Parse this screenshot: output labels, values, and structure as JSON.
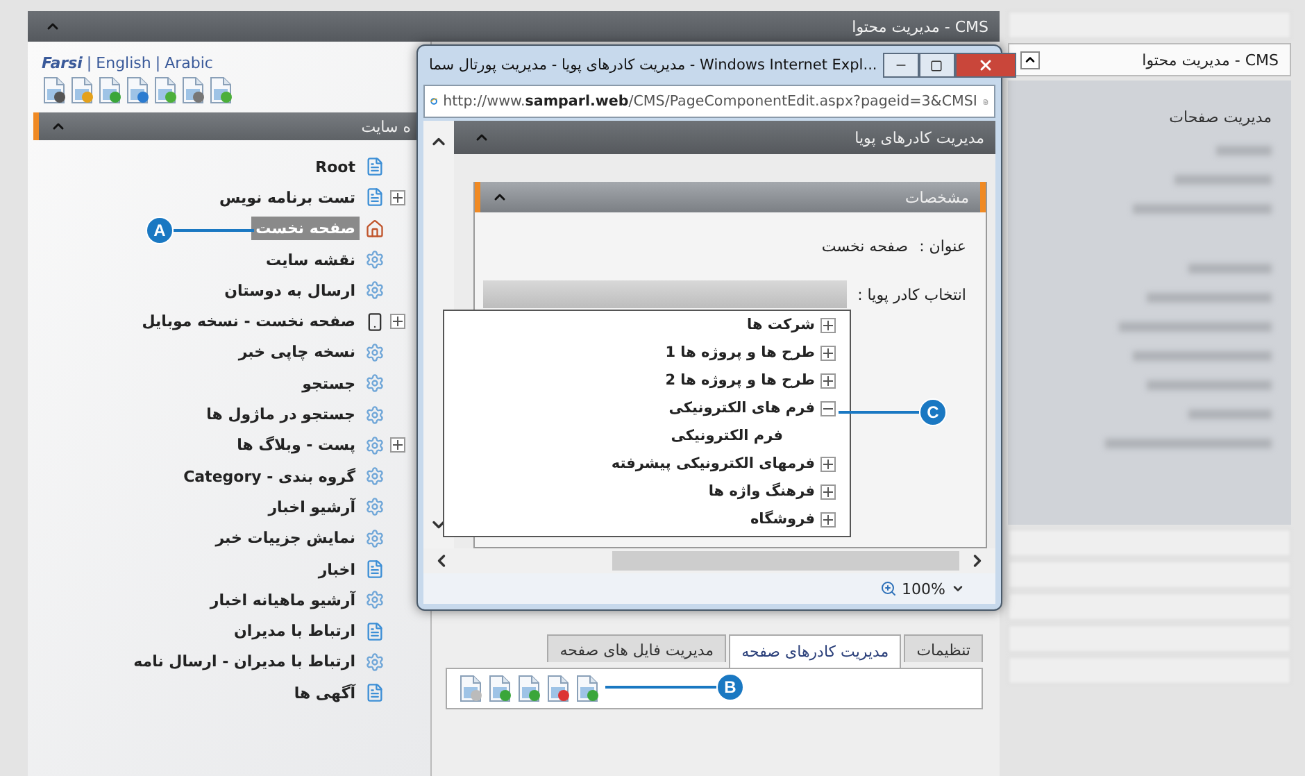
{
  "header": {
    "title": "مدیریت محتوا - CMS"
  },
  "languages": [
    {
      "label": "Arabic",
      "selected": false
    },
    {
      "label": "English",
      "selected": false
    },
    {
      "label": "Farsi",
      "selected": true
    }
  ],
  "language_separators": [
    "|",
    "|"
  ],
  "site_tree": {
    "title": "ه سایت",
    "root": "Root",
    "items": [
      {
        "label": "تست برنامه نویس",
        "kind": "page",
        "expandable": true,
        "selected": false
      },
      {
        "label": "صفحه نخست",
        "kind": "home",
        "expandable": false,
        "selected": true
      },
      {
        "label": "نقشه سایت",
        "kind": "gear",
        "expandable": false,
        "selected": false
      },
      {
        "label": "ارسال به دوستان",
        "kind": "gear",
        "expandable": false,
        "selected": false
      },
      {
        "label": "صفحه نخست - نسخه موبایل",
        "kind": "mobile",
        "expandable": true,
        "selected": false
      },
      {
        "label": "نسخه چاپی خبر",
        "kind": "gear",
        "expandable": false,
        "selected": false
      },
      {
        "label": "جستجو",
        "kind": "gear",
        "expandable": false,
        "selected": false
      },
      {
        "label": "جستجو در ماژول ها",
        "kind": "gear",
        "expandable": false,
        "selected": false
      },
      {
        "label": "پست - وبلاگ ها",
        "kind": "gear",
        "expandable": true,
        "selected": false
      },
      {
        "label": "گروه بندی - Category",
        "kind": "gear",
        "expandable": false,
        "selected": false
      },
      {
        "label": "آرشیو اخبار",
        "kind": "gear",
        "expandable": false,
        "selected": false
      },
      {
        "label": "نمایش جزییات خبر",
        "kind": "gear",
        "expandable": false,
        "selected": false
      },
      {
        "label": "اخبار",
        "kind": "page",
        "expandable": false,
        "selected": false
      },
      {
        "label": "آرشیو ماهیانه اخبار",
        "kind": "gear",
        "expandable": false,
        "selected": false
      },
      {
        "label": "ارتباط با مدیران",
        "kind": "page",
        "expandable": false,
        "selected": false
      },
      {
        "label": "ارتباط با مدیران - ارسال نامه",
        "kind": "gear",
        "expandable": false,
        "selected": false
      },
      {
        "label": "آگهی ها",
        "kind": "page",
        "expandable": false,
        "selected": false
      }
    ]
  },
  "page_tabs": [
    {
      "label": "تنظیمات",
      "selected": false
    },
    {
      "label": "مدیریت کادرهای صفحه",
      "selected": true
    },
    {
      "label": "مدیریت فایل های صفحه",
      "selected": false
    }
  ],
  "popup": {
    "title": "مدیریت کادرهای پویا - مدیریت پورتال سما - Windows Internet Expl...",
    "url": "http://www.**samparl.web**/CMS/PageComponentEdit.aspx?pageid=3&CMSI",
    "panel_title": "مدیریت کادرهای پویا",
    "section_title": "مشخصات",
    "title_label": "عنوان :",
    "title_value": "صفحه نخست",
    "select_label": "انتخاب کادر پویا :",
    "component_tree": [
      {
        "label": "شرکت ها",
        "expanded": false
      },
      {
        "label": "طرح ها و پروژه ها 1",
        "expanded": false
      },
      {
        "label": "طرح ها و پروژه ها 2",
        "expanded": false
      },
      {
        "label": "فرم های الکترونیکی",
        "expanded": true,
        "children": [
          {
            "label": "فرم الکترونیکی"
          }
        ]
      },
      {
        "label": "فرمهای الکترونیکی پیشرفته",
        "expanded": false
      },
      {
        "label": "فرهنگ واژه ها",
        "expanded": false
      },
      {
        "label": "فروشگاه",
        "expanded": false
      }
    ],
    "zoom": "100%"
  },
  "sidebar": {
    "title": "مدیریت محتوا - CMS",
    "item": "مدیریت صفحات"
  },
  "callouts": [
    {
      "letter": "A"
    },
    {
      "letter": "B"
    },
    {
      "letter": "C"
    }
  ]
}
